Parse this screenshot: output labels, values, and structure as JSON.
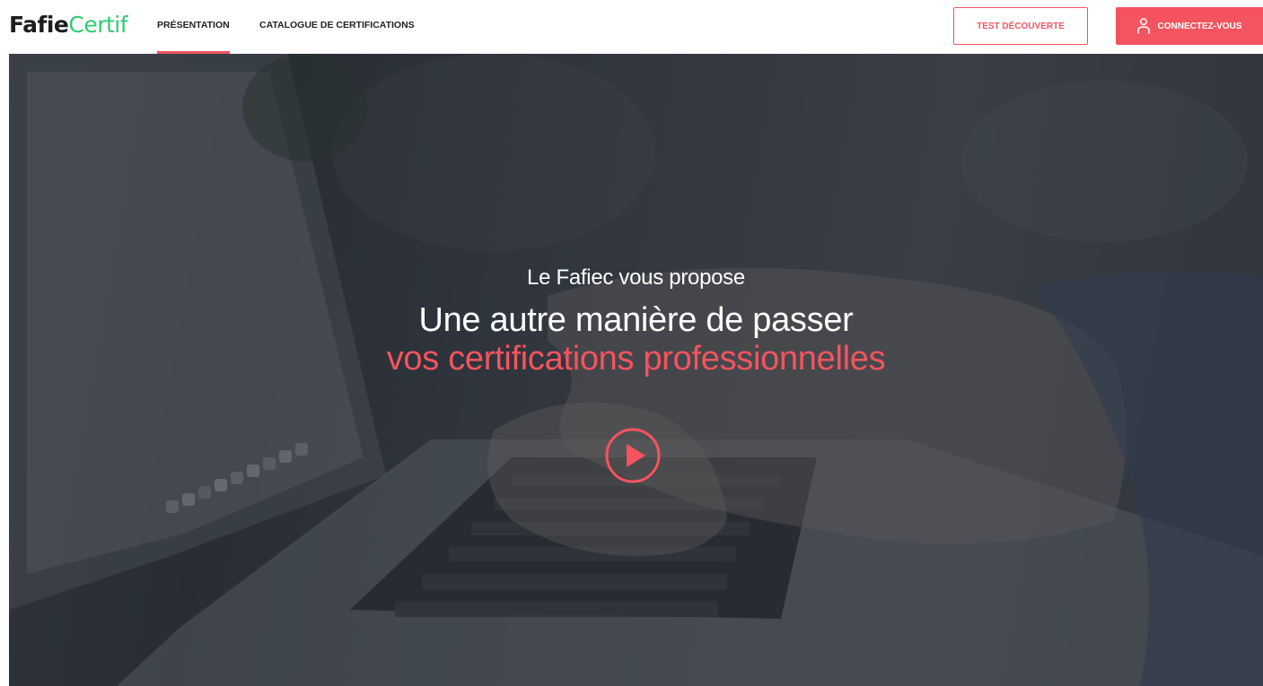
{
  "header": {
    "logo": {
      "part1": "Fafie",
      "part2": "Certif"
    },
    "nav": [
      {
        "label": "PRÉSENTATION",
        "active": true
      },
      {
        "label": "CATALOGUE DE CERTIFICATIONS",
        "active": false
      }
    ],
    "test_button_label": "TEST DÉCOUVERTE",
    "login_button_label": "CONNECTEZ-VOUS",
    "login_icon": "user-icon"
  },
  "hero": {
    "intro": "Le Fafiec vous propose",
    "title": "Une autre manière de passer",
    "subtitle": "vos certifications professionnelles",
    "play_icon": "play-icon"
  },
  "colors": {
    "accent": "#f4545f",
    "logo_accent": "#2ecc71",
    "text_dark": "#222222"
  }
}
